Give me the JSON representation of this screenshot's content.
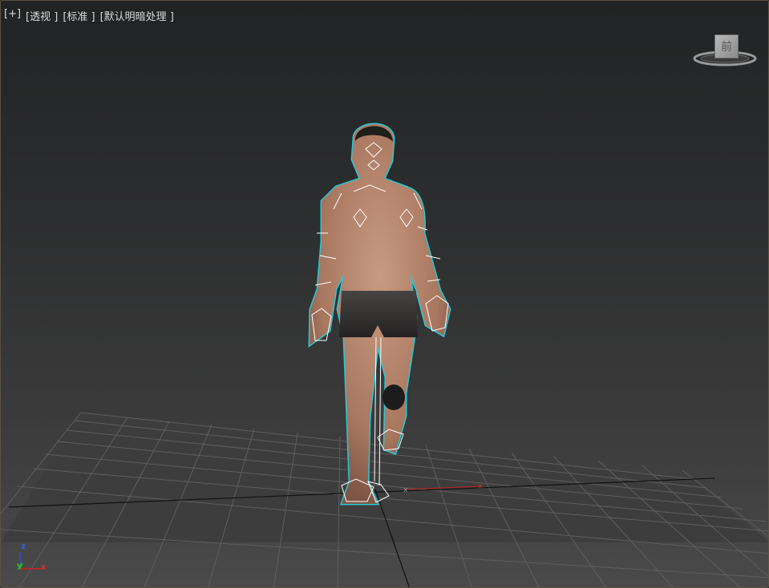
{
  "viewport": {
    "labels": [
      "[+]",
      "[透视 ]",
      "[标准 ]",
      "[默认明暗处理 ]"
    ],
    "viewcube_face": "前",
    "axes": {
      "x": "x",
      "y": "y",
      "z": "z"
    },
    "origin_marker": "x",
    "colors": {
      "selection_outline": "#29c7d6",
      "x_axis": "#d02020",
      "y_axis": "#20b020",
      "z_axis": "#2040d0",
      "grid": "#606060",
      "skin": "#b98a74",
      "shorts": "#2e2c2c"
    }
  }
}
